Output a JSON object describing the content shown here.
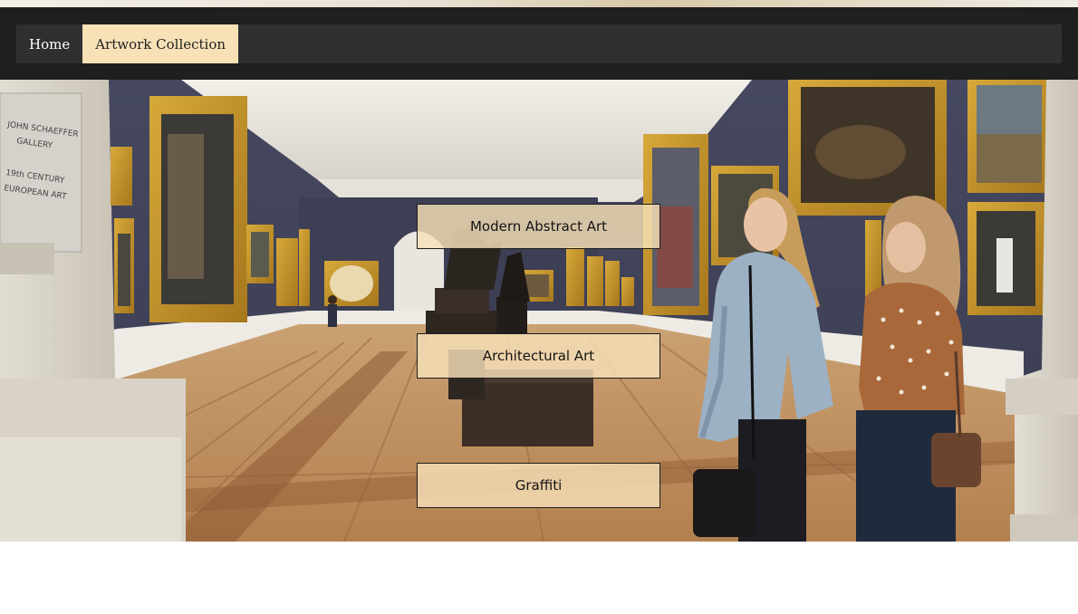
{
  "nav": {
    "items": [
      {
        "label": "Home",
        "active": false
      },
      {
        "label": "Artwork Collection",
        "active": true
      }
    ],
    "active_color": "#f8e1b6",
    "bar_color": "#2f2f2f"
  },
  "hero": {
    "image": "museum-gallery-photo",
    "gallery_sign": {
      "lines": [
        "JOHN SCHAEFFER",
        "GALLERY",
        "19th CENTURY",
        "EUROPEAN ART"
      ]
    },
    "buttons": [
      {
        "label": "Modern Abstract Art"
      },
      {
        "label": "Architectural Art"
      },
      {
        "label": "Graffiti"
      }
    ]
  }
}
